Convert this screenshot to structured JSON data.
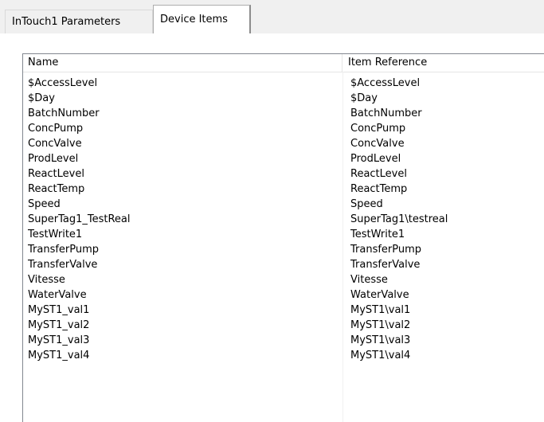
{
  "tabs": [
    {
      "label": "InTouch1 Parameters",
      "active": false
    },
    {
      "label": "Device Items",
      "active": true
    }
  ],
  "list": {
    "columns": [
      "Name",
      "Item Reference"
    ],
    "rows": [
      {
        "name": "$AccessLevel",
        "ref": "$AccessLevel"
      },
      {
        "name": "$Day",
        "ref": "$Day"
      },
      {
        "name": "BatchNumber",
        "ref": "BatchNumber"
      },
      {
        "name": "ConcPump",
        "ref": "ConcPump"
      },
      {
        "name": "ConcValve",
        "ref": "ConcValve"
      },
      {
        "name": "ProdLevel",
        "ref": "ProdLevel"
      },
      {
        "name": "ReactLevel",
        "ref": "ReactLevel"
      },
      {
        "name": "ReactTemp",
        "ref": "ReactTemp"
      },
      {
        "name": "Speed",
        "ref": "Speed"
      },
      {
        "name": "SuperTag1_TestReal",
        "ref": "SuperTag1\\testreal"
      },
      {
        "name": "TestWrite1",
        "ref": "TestWrite1"
      },
      {
        "name": "TransferPump",
        "ref": "TransferPump"
      },
      {
        "name": "TransferValve",
        "ref": "TransferValve"
      },
      {
        "name": "Vitesse",
        "ref": "Vitesse"
      },
      {
        "name": "WaterValve",
        "ref": "WaterValve"
      },
      {
        "name": "MyST1_val1",
        "ref": "MyST1\\val1"
      },
      {
        "name": "MyST1_val2",
        "ref": "MyST1\\val2"
      },
      {
        "name": "MyST1_val3",
        "ref": "MyST1\\val3"
      },
      {
        "name": "MyST1_val4",
        "ref": "MyST1\\val4"
      }
    ]
  }
}
